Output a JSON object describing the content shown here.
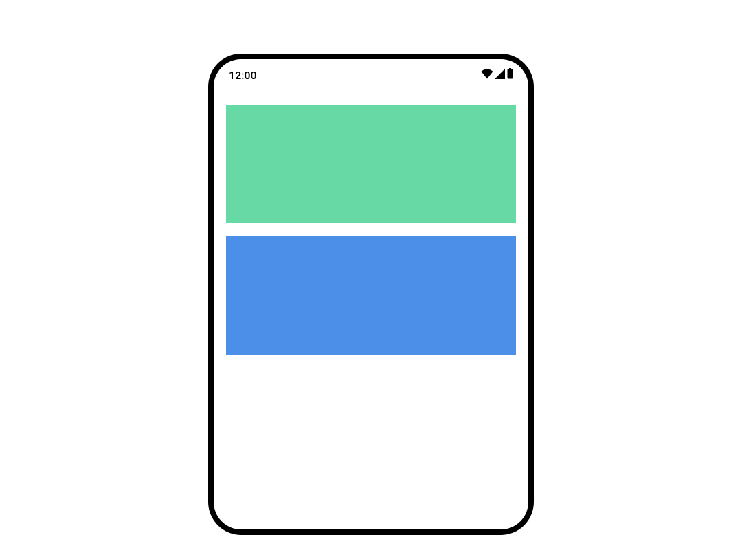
{
  "statusBar": {
    "time": "12:00"
  },
  "blocks": {
    "green": "#66d9a5",
    "blue": "#4c8fe8"
  }
}
